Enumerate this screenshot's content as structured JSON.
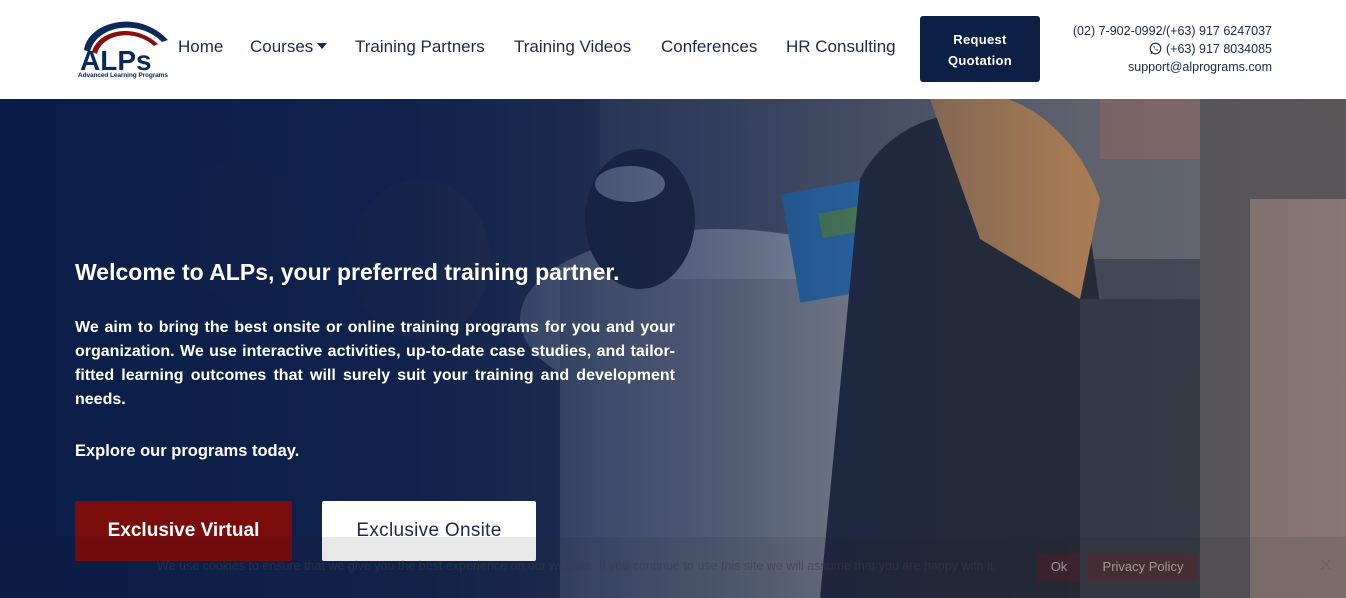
{
  "logo": {
    "text": "ALPs",
    "tagline": "Advanced Learning Programs"
  },
  "nav": {
    "items": [
      {
        "label": "Home"
      },
      {
        "label": "Courses"
      },
      {
        "label": "Training Partners"
      },
      {
        "label": "Training Videos"
      },
      {
        "label": "Conferences"
      },
      {
        "label": "HR Consulting"
      }
    ]
  },
  "header": {
    "quote_line1": "Request",
    "quote_line2": "Quotation",
    "phone": "(02) 7-902-0992/(+63) 917 6247037",
    "whatsapp": "(+63) 917 8034085",
    "email": "support@alprograms.com",
    "whatsapp_icon": "whatsapp-icon"
  },
  "hero": {
    "title": "Welcome to ALPs, your preferred training partner.",
    "description": "We aim to bring the best onsite or online training programs for you and your organization. We use interactive activities, up-to-date case studies, and tailor-fitted learning outcomes that will surely suit your training and development needs.",
    "explore": "Explore our programs today.",
    "btn_virtual": "Exclusive Virtual",
    "btn_onsite": "Exclusive Onsite"
  },
  "cookie": {
    "text": "We use cookies to ensure that we give you the best experience on our website. If you continue to use this site we will assume that you are happy with it.",
    "ok": "Ok",
    "policy": "Privacy Policy",
    "close": "✕"
  },
  "colors": {
    "navy": "#0c1f45",
    "maroon": "#7a0c0c",
    "text_dark": "#1b2a4a"
  }
}
